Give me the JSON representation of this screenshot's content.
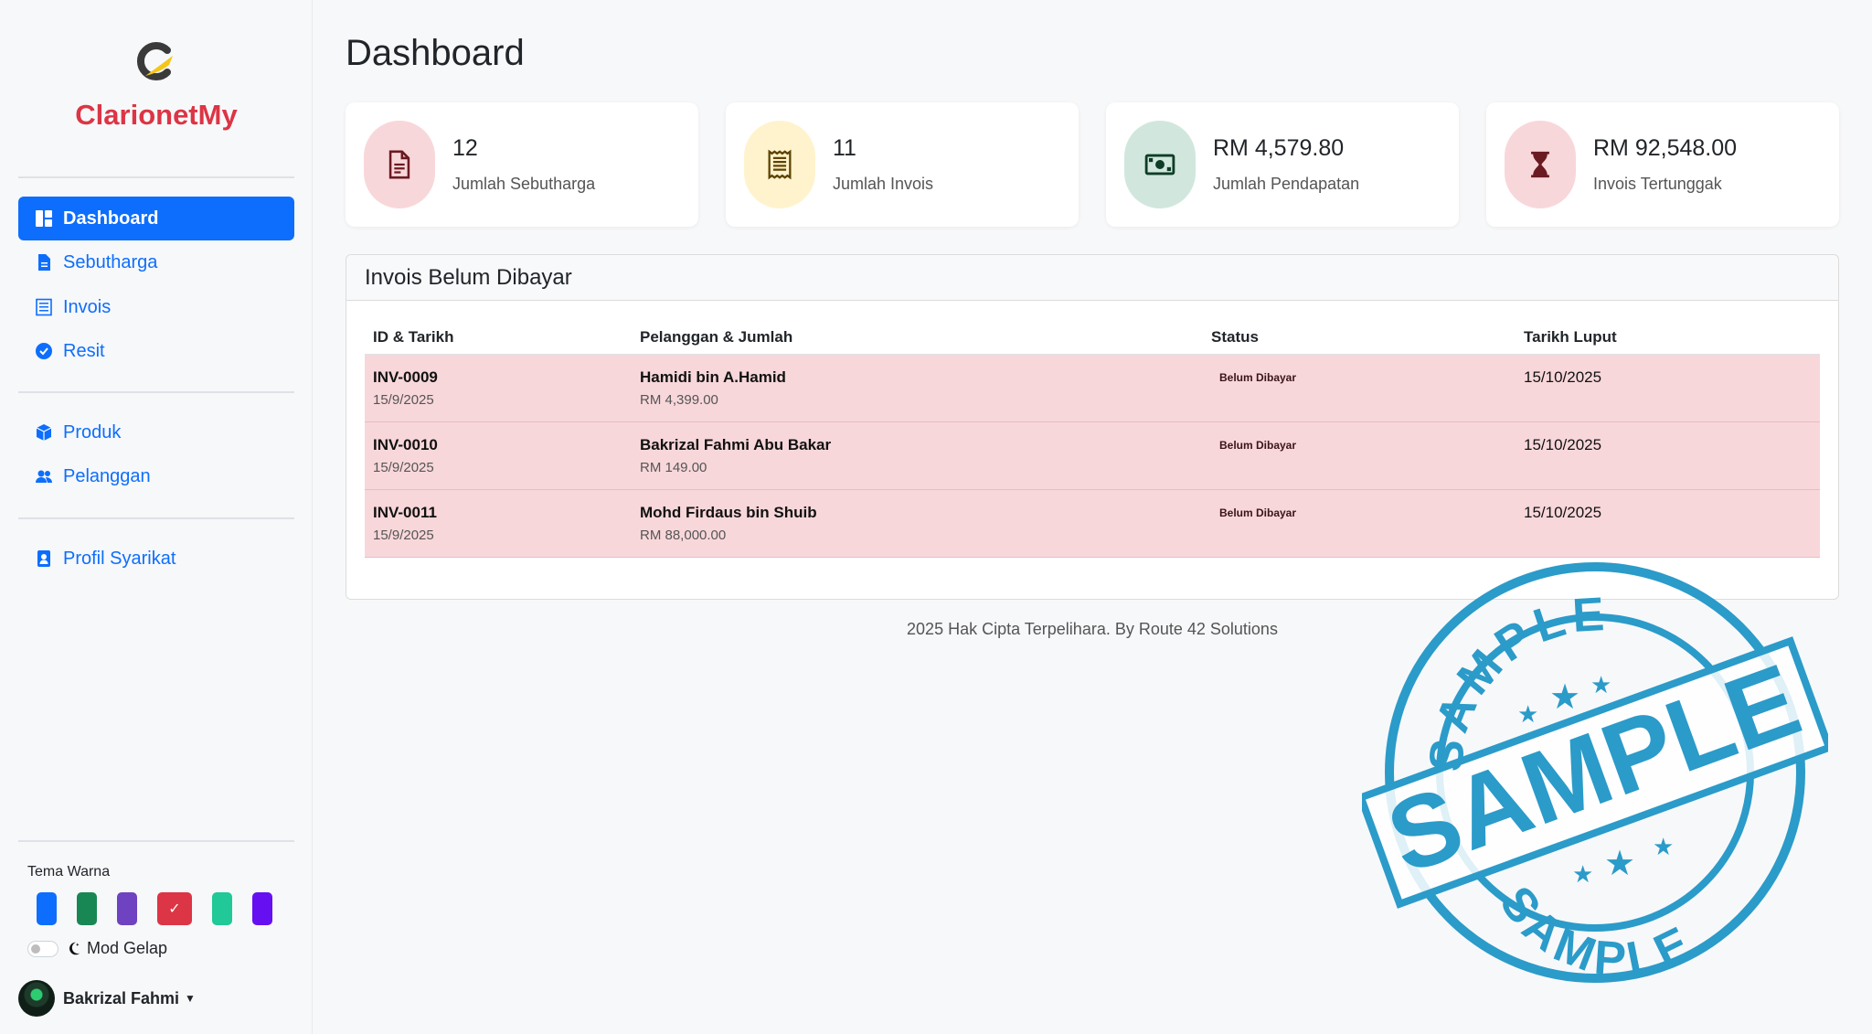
{
  "brand": {
    "name": "ClarionetMy"
  },
  "nav": {
    "group1": [
      {
        "label": "Dashboard",
        "icon": "dashboard-icon",
        "active": true
      },
      {
        "label": "Sebutharga",
        "icon": "document-icon"
      },
      {
        "label": "Invois",
        "icon": "invoice-icon"
      },
      {
        "label": "Resit",
        "icon": "badge-check-icon"
      }
    ],
    "group2": [
      {
        "label": "Produk",
        "icon": "box-icon"
      },
      {
        "label": "Pelanggan",
        "icon": "users-icon"
      }
    ],
    "group3": [
      {
        "label": "Profil Syarikat",
        "icon": "profile-card-icon"
      }
    ]
  },
  "theme": {
    "label": "Tema Warna",
    "colors": [
      "#0d6efd",
      "#198754",
      "#6f42c1",
      "#dc3545",
      "#20c997",
      "#6610f2"
    ],
    "selected_index": 3
  },
  "dark_mode": {
    "label": "Mod Gelap",
    "enabled": false
  },
  "user": {
    "name": "Bakrizal Fahmi"
  },
  "page": {
    "title": "Dashboard"
  },
  "stats": [
    {
      "value": "12",
      "label": "Jumlah Sebutharga",
      "icon": "document-icon",
      "bg": "#f8d7da",
      "fg": "#6b1a22"
    },
    {
      "value": "11",
      "label": "Jumlah Invois",
      "icon": "receipt-icon",
      "bg": "#fff3cd",
      "fg": "#5c4300"
    },
    {
      "value": "RM 4,579.80",
      "label": "Jumlah Pendapatan",
      "icon": "cash-icon",
      "bg": "#d1e7dd",
      "fg": "#0f3d27"
    },
    {
      "value": "RM 92,548.00",
      "label": "Invois Tertunggak",
      "icon": "hourglass-icon",
      "bg": "#f8d7da",
      "fg": "#6b1a22"
    }
  ],
  "unpaid": {
    "title": "Invois Belum Dibayar",
    "columns": [
      "ID & Tarikh",
      "Pelanggan & Jumlah",
      "Status",
      "Tarikh Luput"
    ],
    "rows": [
      {
        "id": "INV-0009",
        "date": "15/9/2025",
        "customer": "Hamidi bin A.Hamid",
        "amount": "RM 4,399.00",
        "status": "Belum Dibayar",
        "due": "15/10/2025"
      },
      {
        "id": "INV-0010",
        "date": "15/9/2025",
        "customer": "Bakrizal Fahmi Abu Bakar",
        "amount": "RM 149.00",
        "status": "Belum Dibayar",
        "due": "15/10/2025"
      },
      {
        "id": "INV-0011",
        "date": "15/9/2025",
        "customer": "Mohd Firdaus bin Shuib",
        "amount": "RM 88,000.00",
        "status": "Belum Dibayar",
        "due": "15/10/2025"
      }
    ]
  },
  "footer": {
    "text": "2025 Hak Cipta Terpelihara. By Route 42 Solutions"
  },
  "watermark": {
    "text": "SAMPLE",
    "color": "#2b9bc9"
  }
}
